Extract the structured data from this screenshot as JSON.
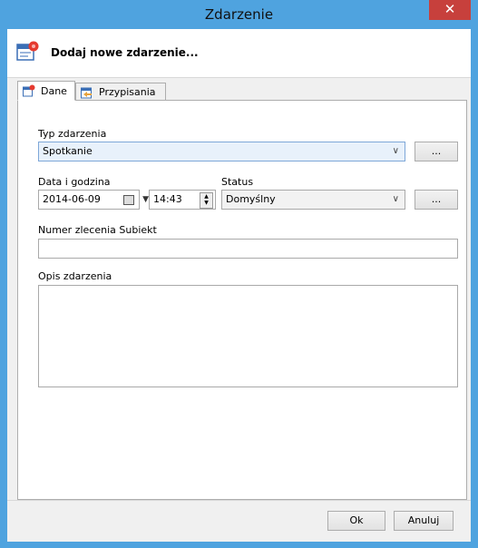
{
  "window": {
    "title": "Zdarzenie",
    "close_glyph": "✕"
  },
  "header": {
    "text": "Dodaj nowe zdarzenie...",
    "icon": "calendar-event-icon"
  },
  "tabs": [
    {
      "label": "Dane",
      "icon": "calendar-event-icon",
      "active": true
    },
    {
      "label": "Przypisania",
      "icon": "assign-icon",
      "active": false
    }
  ],
  "form": {
    "event_type": {
      "label": "Typ zdarzenia",
      "value": "Spotkanie",
      "browse": "..."
    },
    "datetime": {
      "label": "Data i godzina",
      "date": "2014-06-09",
      "time": "14:43"
    },
    "status": {
      "label": "Status",
      "value": "Domyślny",
      "browse": "..."
    },
    "order_number": {
      "label": "Numer zlecenia Subiekt",
      "value": ""
    },
    "description": {
      "label": "Opis zdarzenia",
      "value": ""
    }
  },
  "buttons": {
    "ok": "Ok",
    "cancel": "Anuluj"
  },
  "colors": {
    "titlebar": "#4fa3df",
    "close": "#c7403c",
    "selected_combo": "#e8f1fb"
  }
}
